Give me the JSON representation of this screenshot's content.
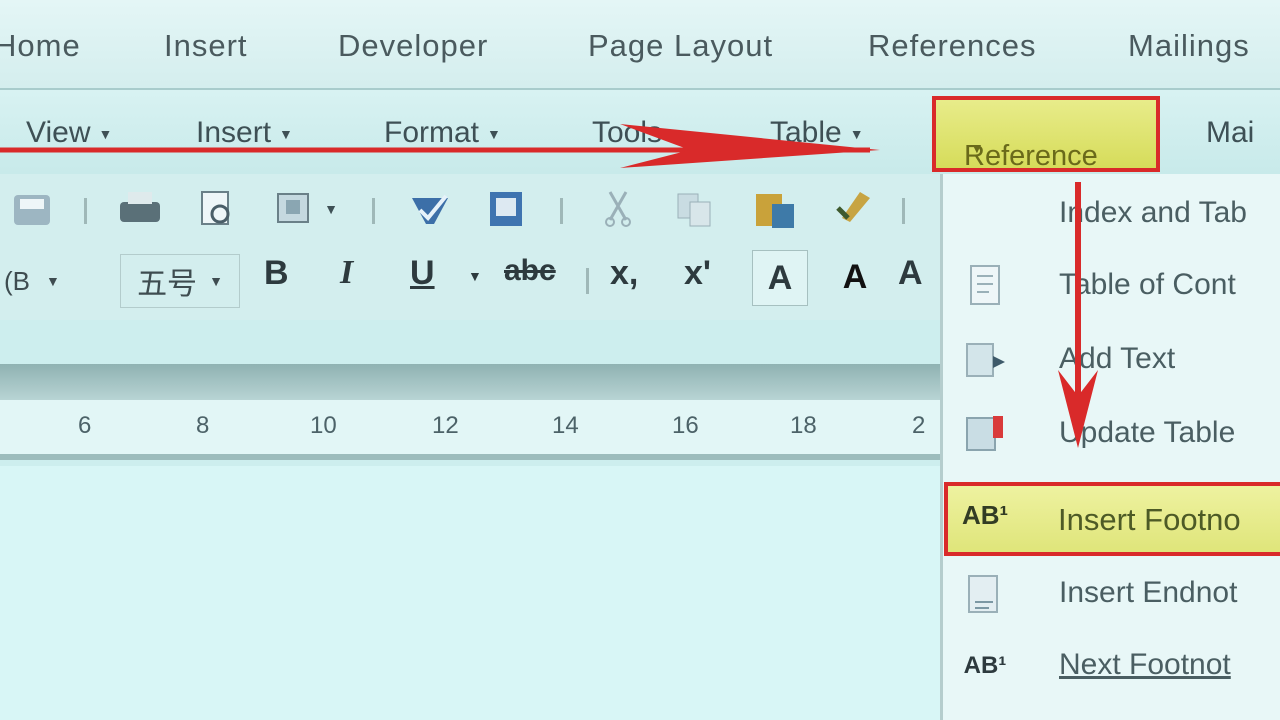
{
  "ribbon_tabs": [
    "Home",
    "Insert",
    "Developer",
    "Page Layout",
    "References",
    "Mailings"
  ],
  "menu_bar": {
    "items": [
      "View",
      "Insert",
      "Format",
      "Tools",
      "Table"
    ],
    "highlighted": "Reference",
    "partial": "Mai"
  },
  "toolbar": {
    "style_value": "(B",
    "size_value": "五号",
    "bold_label": "B",
    "italic_label": "I",
    "underline_label": "U",
    "strike_label": "abc",
    "subscript_label": "x,",
    "superscript_label": "x'",
    "font_color_label": "A",
    "highlight_label": "A",
    "char_scale_label": "A"
  },
  "ruler": {
    "numbers": [
      "6",
      "8",
      "10",
      "12",
      "14",
      "16",
      "18",
      "2"
    ]
  },
  "reference_menu": {
    "items": [
      {
        "label": "Index and Tab",
        "icon": "index-icon"
      },
      {
        "label": "Table of Cont",
        "icon": "toc-icon"
      },
      {
        "label": "Add Text",
        "icon": "add-text-icon"
      },
      {
        "label": "Update Table",
        "icon": "update-table-icon"
      }
    ],
    "highlighted_item": {
      "label": "Insert Footno",
      "icon_text": "AB¹"
    },
    "after_items": [
      {
        "label": "Insert Endnot",
        "icon": "endnote-icon"
      },
      {
        "label": "Next Footnot",
        "icon_text": "AB¹"
      }
    ]
  },
  "colors": {
    "annotation": "#d92a2a",
    "highlight": "#dfe57a",
    "background": "#cdeeee"
  }
}
